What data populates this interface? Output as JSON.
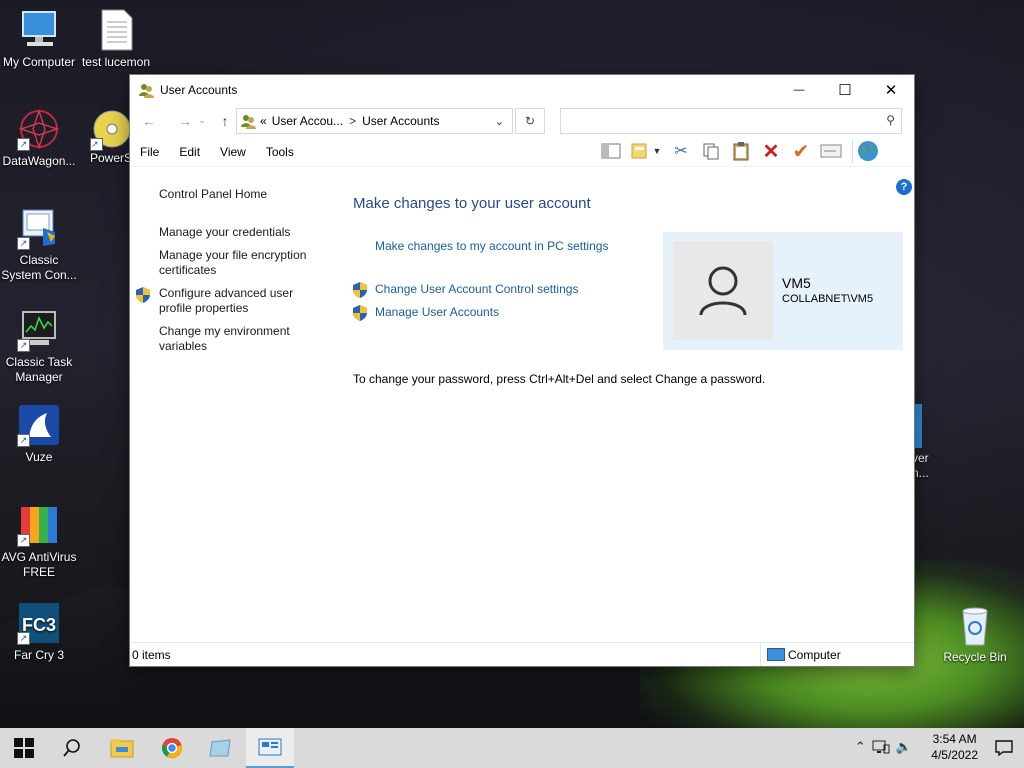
{
  "desktop": {
    "icons": [
      {
        "label": "My Computer"
      },
      {
        "label": "test lucemon"
      },
      {
        "label": "DataWagon..."
      },
      {
        "label": "PowerS"
      },
      {
        "label": "Classic System Con..."
      },
      {
        "label": "Classic Task Manager"
      },
      {
        "label": "Vuze"
      },
      {
        "label": "AVG AntiVirus FREE"
      },
      {
        "label": "Far Cry 3"
      },
      {
        "label": "Recycle Bin"
      },
      {
        "label": "ver"
      },
      {
        "label": "n..."
      }
    ]
  },
  "window": {
    "title": "User Accounts",
    "controls": {
      "minimize": "—",
      "maximize": "☐",
      "close": "✕"
    },
    "address": {
      "crumb_prefix": "«",
      "crumb1": "User Accou...",
      "separator": ">",
      "crumb2": "User Accounts"
    },
    "search": {
      "placeholder": ""
    },
    "menu": [
      "File",
      "Edit",
      "View",
      "Tools"
    ],
    "left_nav": {
      "home": "Control Panel Home",
      "links": [
        "Manage your credentials",
        "Manage your file encryption certificates",
        "Configure advanced user profile properties",
        "Change my environment variables"
      ]
    },
    "main": {
      "heading": "Make changes to your user account",
      "pc_settings_link": "Make changes to my account in PC settings",
      "uac_link": "Change User Account Control settings",
      "manage_link": "Manage User Accounts",
      "password_note": "To change your password, press Ctrl+Alt+Del and select Change a password."
    },
    "account": {
      "name": "VM5",
      "domain": "COLLABNET\\VM5"
    },
    "status": {
      "items": "0 items",
      "location": "Computer"
    },
    "help_label": "?"
  },
  "taskbar": {
    "time": "3:54 AM",
    "date": "4/5/2022"
  },
  "colors": {
    "link": "#1a5ea8",
    "heading": "#244b8f",
    "account_bg": "#e5f1fb",
    "taskbar": "#dadada"
  }
}
